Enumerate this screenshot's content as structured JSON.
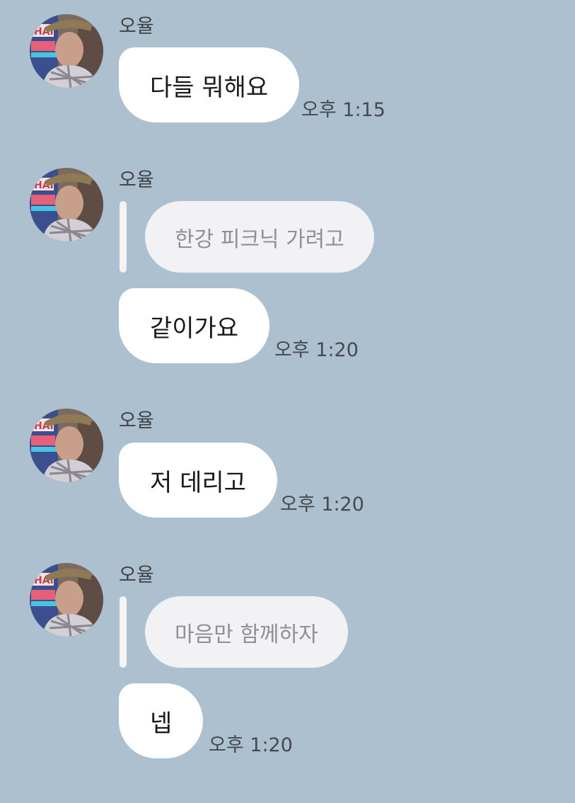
{
  "messages": [
    {
      "sender": "오율",
      "reply": null,
      "text": "다들 뭐해요",
      "time": "오후 1:15"
    },
    {
      "sender": "오율",
      "reply": "한강 피크닉 가려고",
      "text": "같이가요",
      "time": "오후 1:20"
    },
    {
      "sender": "오율",
      "reply": null,
      "text": "저 데리고",
      "time": "오후 1:20"
    },
    {
      "sender": "오율",
      "reply": "마음만 함께하자",
      "text": "넵",
      "time": "오후 1:20"
    }
  ],
  "colors": {
    "background": "#adc0d0",
    "bubble": "#ffffff",
    "reply_bubble": "#f2f2f5",
    "reply_text": "#8d9098",
    "time_text": "#454a52"
  }
}
